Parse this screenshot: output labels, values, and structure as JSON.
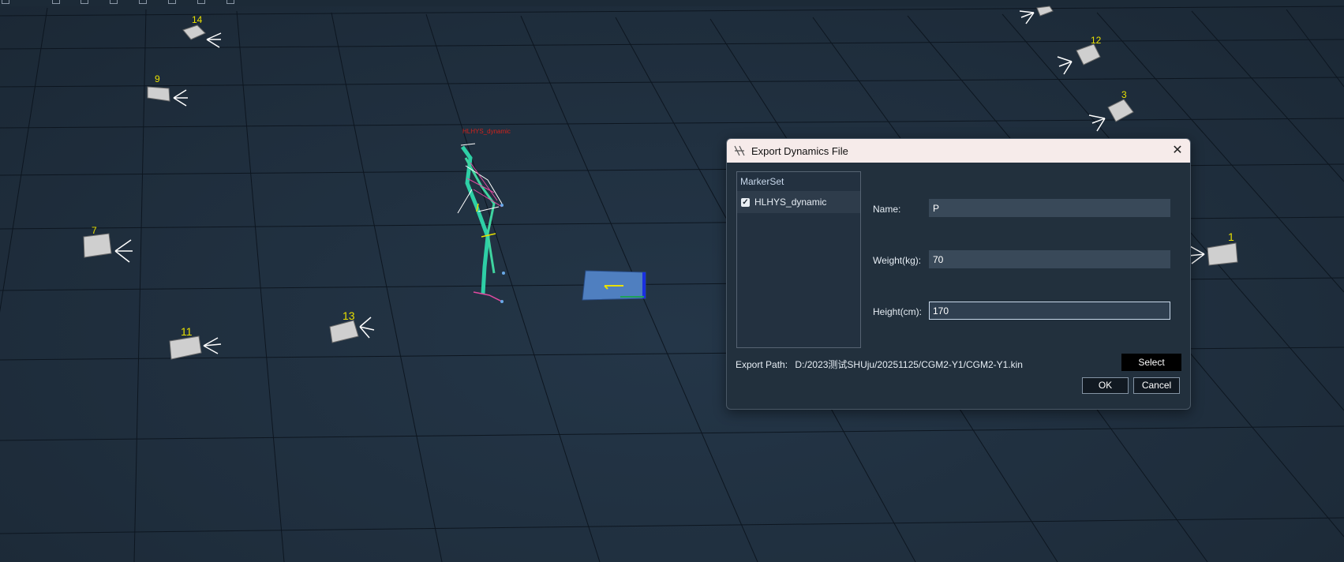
{
  "scene": {
    "camera_labels": [
      "14",
      "9",
      "7",
      "11",
      "13",
      "12",
      "3",
      "1"
    ],
    "subject_label": "HLHYS_dynamic"
  },
  "dialog": {
    "title": "Export Dynamics File",
    "close_symbol": "✕",
    "markerset": {
      "header": "MarkerSet",
      "items": [
        {
          "label": "HLHYS_dynamic",
          "checked": true
        }
      ]
    },
    "fields": {
      "name_label": "Name:",
      "name_value": "P",
      "weight_label": "Weight(kg):",
      "weight_value": "70",
      "height_label": "Height(cm):",
      "height_value": "170"
    },
    "export_path_label": "Export Path:",
    "export_path_value": "D:/2023测试SHUju/20251125/CGM2-Y1/CGM2-Y1.kin",
    "select_label": "Select",
    "ok_label": "OK",
    "cancel_label": "Cancel"
  },
  "icons": {
    "dialog_logo": "app-logo-icon",
    "close": "close-icon",
    "checkbox": "checkmark-icon",
    "camera": "camera-icon"
  },
  "colors": {
    "background": "#1f2e3d",
    "grid_line": "#0d1620",
    "camera_label": "#e8e000",
    "subject_label": "#d0221c",
    "title_bar": "#f6ebea"
  }
}
